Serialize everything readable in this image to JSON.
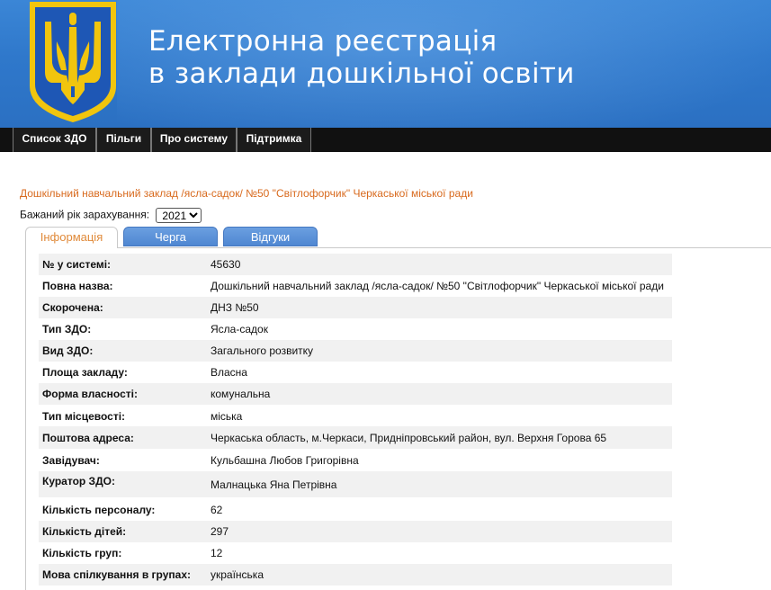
{
  "header": {
    "title_line1": "Електронна реєстрація",
    "title_line2": "в заклади дошкільної освіти",
    "emblem_icon": "ukraine-trident-emblem-icon",
    "colors": {
      "header_blue": "#2f78cb",
      "emblem_gold": "#f1c50e",
      "emblem_blue": "#1e57b5"
    }
  },
  "nav": {
    "items": [
      {
        "label": "Список ЗДО"
      },
      {
        "label": "Пільги"
      },
      {
        "label": "Про систему"
      },
      {
        "label": "Підтримка"
      }
    ]
  },
  "main": {
    "org_title": "Дошкільний навчальний заклад /ясла-садок/ №50 \"Світлофорчик\" Черкаської міської ради",
    "year_label": "Бажаний рік зарахування:",
    "year_value": "2021",
    "tabs": [
      {
        "label": "Інформація",
        "active": true
      },
      {
        "label": "Черга",
        "active": false
      },
      {
        "label": "Відгуки",
        "active": false
      }
    ]
  },
  "info": {
    "rows": [
      {
        "label": "№ у системі:",
        "value": "45630"
      },
      {
        "label": "Повна назва:",
        "value": "Дошкільний навчальний заклад /ясла-садок/ №50 \"Світлофорчик\" Черкаської міської ради"
      },
      {
        "label": "Скорочена:",
        "value": "ДНЗ №50"
      },
      {
        "label": "Тип ЗДО:",
        "value": "Ясла-садок"
      },
      {
        "label": "Вид ЗДО:",
        "value": "Загального розвитку"
      },
      {
        "label": "Площа закладу:",
        "value": "Власна"
      },
      {
        "label": "Форма власності:",
        "value": "комунальна"
      },
      {
        "label": "Тип місцевості:",
        "value": "міська"
      },
      {
        "label": "Поштова адреса:",
        "value": "Черкаська область, м.Черкаси, Придніпровський район, вул. Верхня Горова 65"
      },
      {
        "label": "Завідувач:",
        "value": "Кульбашна Любов Григорівна"
      },
      {
        "label": "Куратор ЗДО:",
        "value": "Малнацька Яна Петрівна"
      },
      {
        "label": "Кількість персоналу:",
        "value": "62"
      },
      {
        "label": "Кількість дітей:",
        "value": "297"
      },
      {
        "label": "Кількість груп:",
        "value": "12"
      },
      {
        "label": "Мова спілкування в групах:",
        "value": "українська"
      }
    ]
  }
}
